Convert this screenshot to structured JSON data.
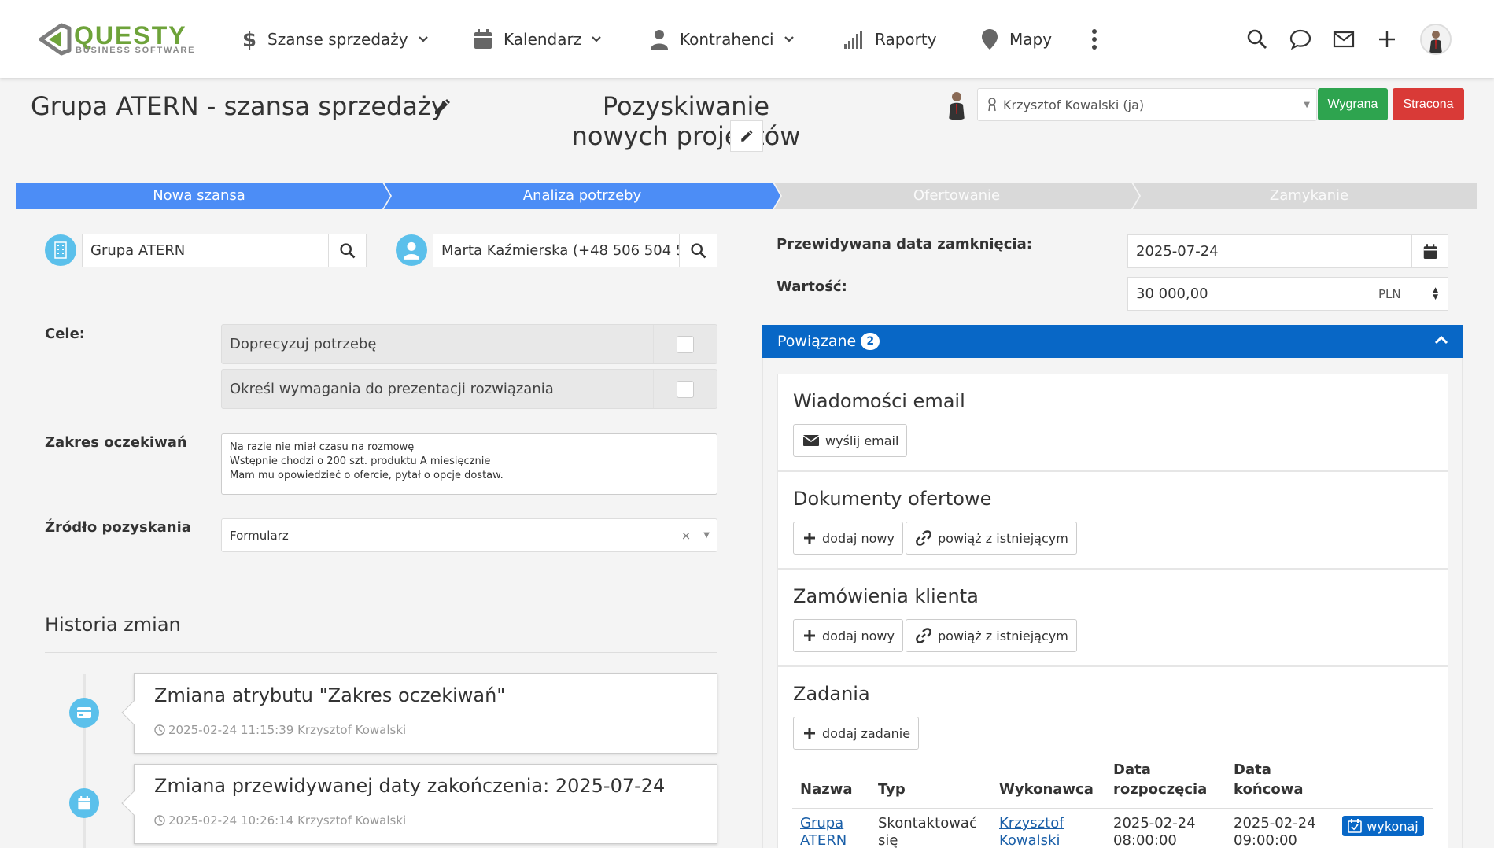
{
  "brand": {
    "name": "QUESTY",
    "tagline": "BUSINESS SOFTWARE",
    "color": "#6ea33a"
  },
  "nav": {
    "items": [
      {
        "label": "Szanse sprzedaży",
        "icon": "dollar-icon"
      },
      {
        "label": "Kalendarz",
        "icon": "calendar-icon"
      },
      {
        "label": "Kontrahenci",
        "icon": "person-icon"
      },
      {
        "label": "Raporty",
        "icon": "signal-bars-icon"
      },
      {
        "label": "Mapy",
        "icon": "map-pin-icon"
      }
    ],
    "more_icon": "vertical-dots-icon",
    "right_icons": [
      "search-icon",
      "chat-icon",
      "mail-icon",
      "plus-icon",
      "user-avatar"
    ]
  },
  "header": {
    "title": "Grupa ATERN - szansa sprzedaży",
    "opportunity_name": "Pozyskiwanie nowych projektów",
    "owner": "Krzysztof Kowalski (ja)",
    "won_label": "Wygrana",
    "lost_label": "Stracona"
  },
  "pipeline": {
    "stages": [
      {
        "label": "Nowa szansa",
        "state": "done"
      },
      {
        "label": "Analiza potrzeby",
        "state": "current"
      },
      {
        "label": "Ofertowanie",
        "state": "todo"
      },
      {
        "label": "Zamykanie",
        "state": "todo"
      }
    ],
    "active_color": "#4c8df6",
    "inactive_color": "#d9d9d9"
  },
  "customer": {
    "company": "Grupa ATERN",
    "contact": "Marta Kaźmierska (+48 506 504 5"
  },
  "goals": {
    "label": "Cele:",
    "items": [
      {
        "text": "Doprecyzuj potrzebę",
        "checked": false
      },
      {
        "text": "Określ wymagania do prezentacji rozwiązania",
        "checked": false
      }
    ]
  },
  "expectations": {
    "label": "Zakres oczekiwań",
    "text": "Na razie nie miał czasu na rozmowę\nWstępnie chodzi o 200 szt. produktu A miesięcznie\nMam mu opowiedzieć o ofercie, pytał o opcje dostaw."
  },
  "source": {
    "label": "Źródło pozyskania",
    "value": "Formularz"
  },
  "history": {
    "title": "Historia zmian",
    "entries": [
      {
        "title": "Zmiana atrybutu \"Zakres oczekiwań\"",
        "meta": "2025-02-24 11:15:39 Krzysztof Kowalski",
        "icon": "card-icon"
      },
      {
        "title": "Zmiana przewidywanej daty zakończenia: 2025-07-24",
        "meta": "2025-02-24 10:26:14 Krzysztof Kowalski",
        "icon": "calendar-icon"
      }
    ]
  },
  "close_date": {
    "label": "Przewidywana data zamknięcia:",
    "value": "2025-07-24"
  },
  "amount": {
    "label": "Wartość:",
    "value": "30 000,00",
    "currency": "PLN"
  },
  "related": {
    "title": "Powiązane",
    "count": "2",
    "color": "#0867c6",
    "email": {
      "title": "Wiadomości email",
      "send_label": "wyślij email"
    },
    "offers": {
      "title": "Dokumenty ofertowe",
      "add_label": "dodaj nowy",
      "link_label": "powiąż z istniejącym"
    },
    "orders": {
      "title": "Zamówienia klienta",
      "add_label": "dodaj nowy",
      "link_label": "powiąż z istniejącym"
    },
    "tasks": {
      "title": "Zadania",
      "add_label": "dodaj zadanie",
      "columns": [
        "Nazwa",
        "Typ",
        "Wykonawca",
        "Data\nrozpoczęcia",
        "Data\nkońcowa"
      ],
      "rows": [
        {
          "name": "Grupa\nATERN",
          "type": "Skontaktować\nsię",
          "assignee": "Krzysztof\nKowalski",
          "start": "2025-02-24\n08:00:00",
          "end": "2025-02-24\n09:00:00",
          "action": "wykonaj"
        }
      ]
    }
  }
}
